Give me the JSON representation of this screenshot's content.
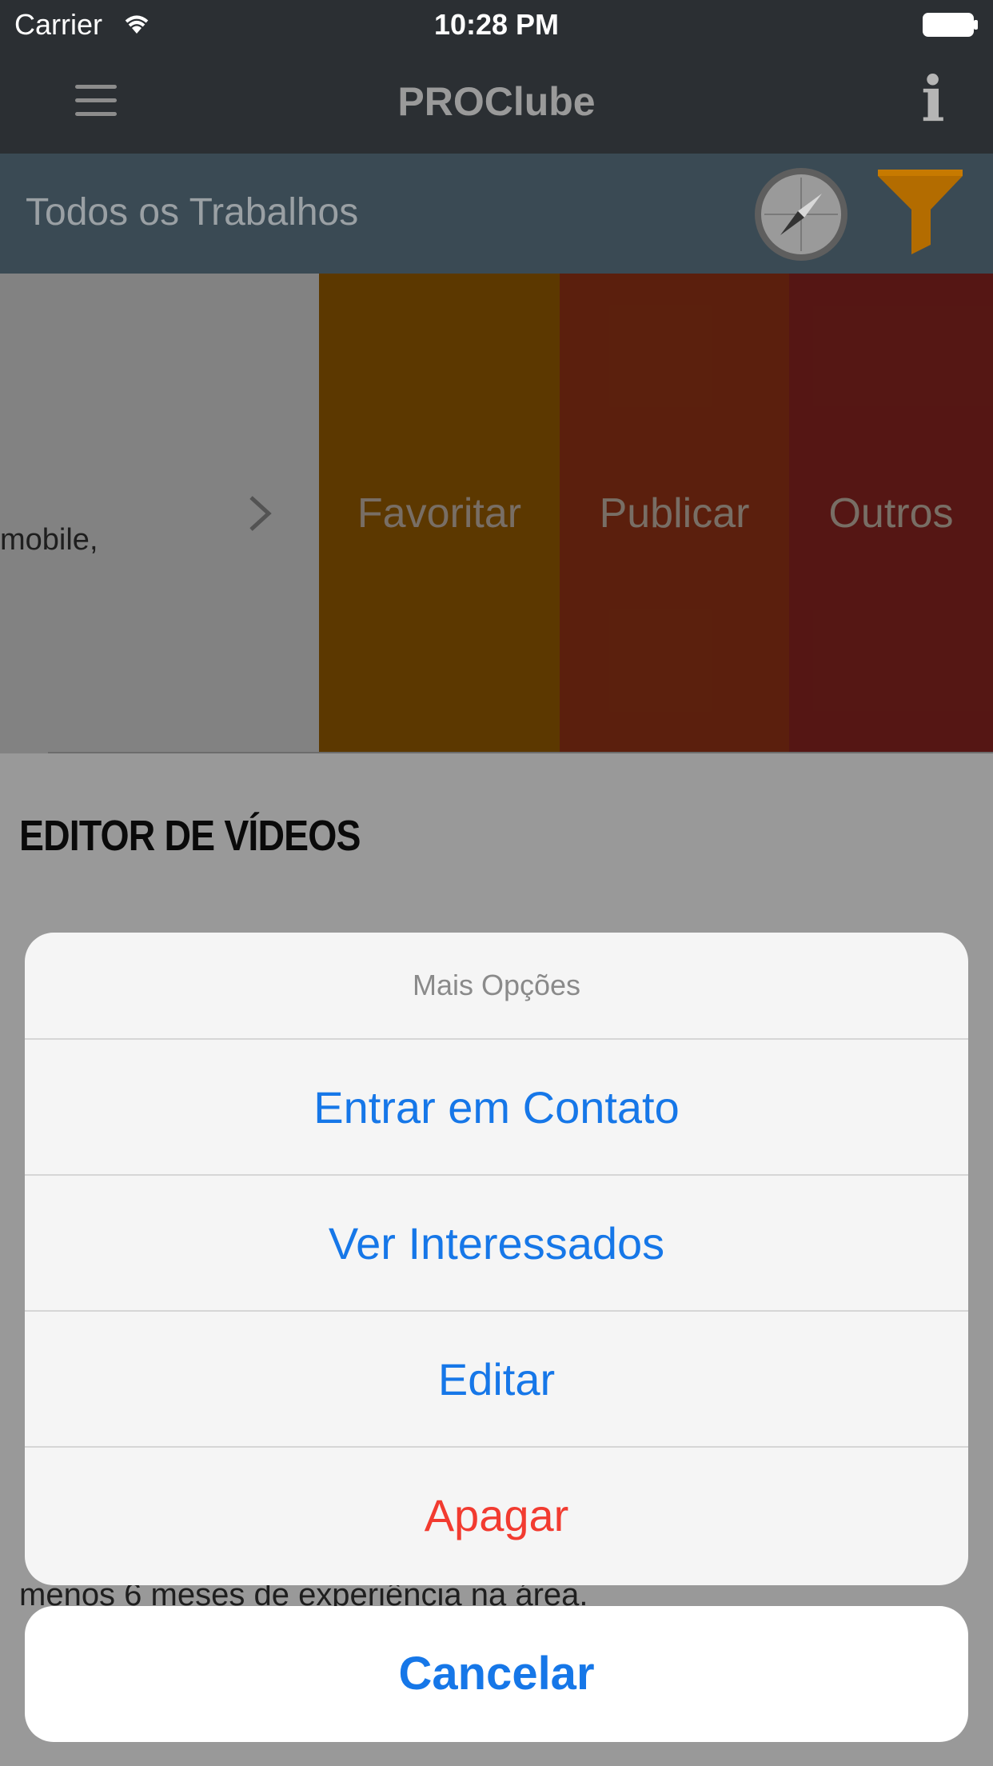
{
  "status_bar": {
    "carrier": "Carrier",
    "time": "10:28 PM"
  },
  "nav": {
    "title": "PROClube",
    "info_icon": "i"
  },
  "sub_header": {
    "title": "Todos os Trabalhos"
  },
  "row": {
    "text": "mobile,",
    "actions": {
      "favoritar": "Favoritar",
      "publicar": "Publicar",
      "outros": "Outros"
    }
  },
  "job": {
    "title": "EDITOR DE VÍDEOS",
    "partial_line": "menos 6 meses de experiência na área."
  },
  "sheet": {
    "title": "Mais Opções",
    "items": [
      "Entrar em Contato",
      "Ver Interessados",
      "Editar",
      "Apagar"
    ],
    "cancel": "Cancelar"
  },
  "colors": {
    "nav_bg": "#2b2f33",
    "sub_header_bg": "#3a4a54",
    "favoritar": "#9a5e00",
    "publicar": "#983516",
    "outros": "#8e2622",
    "action_blue": "#1677e8",
    "destructive_red": "#f23b30"
  }
}
